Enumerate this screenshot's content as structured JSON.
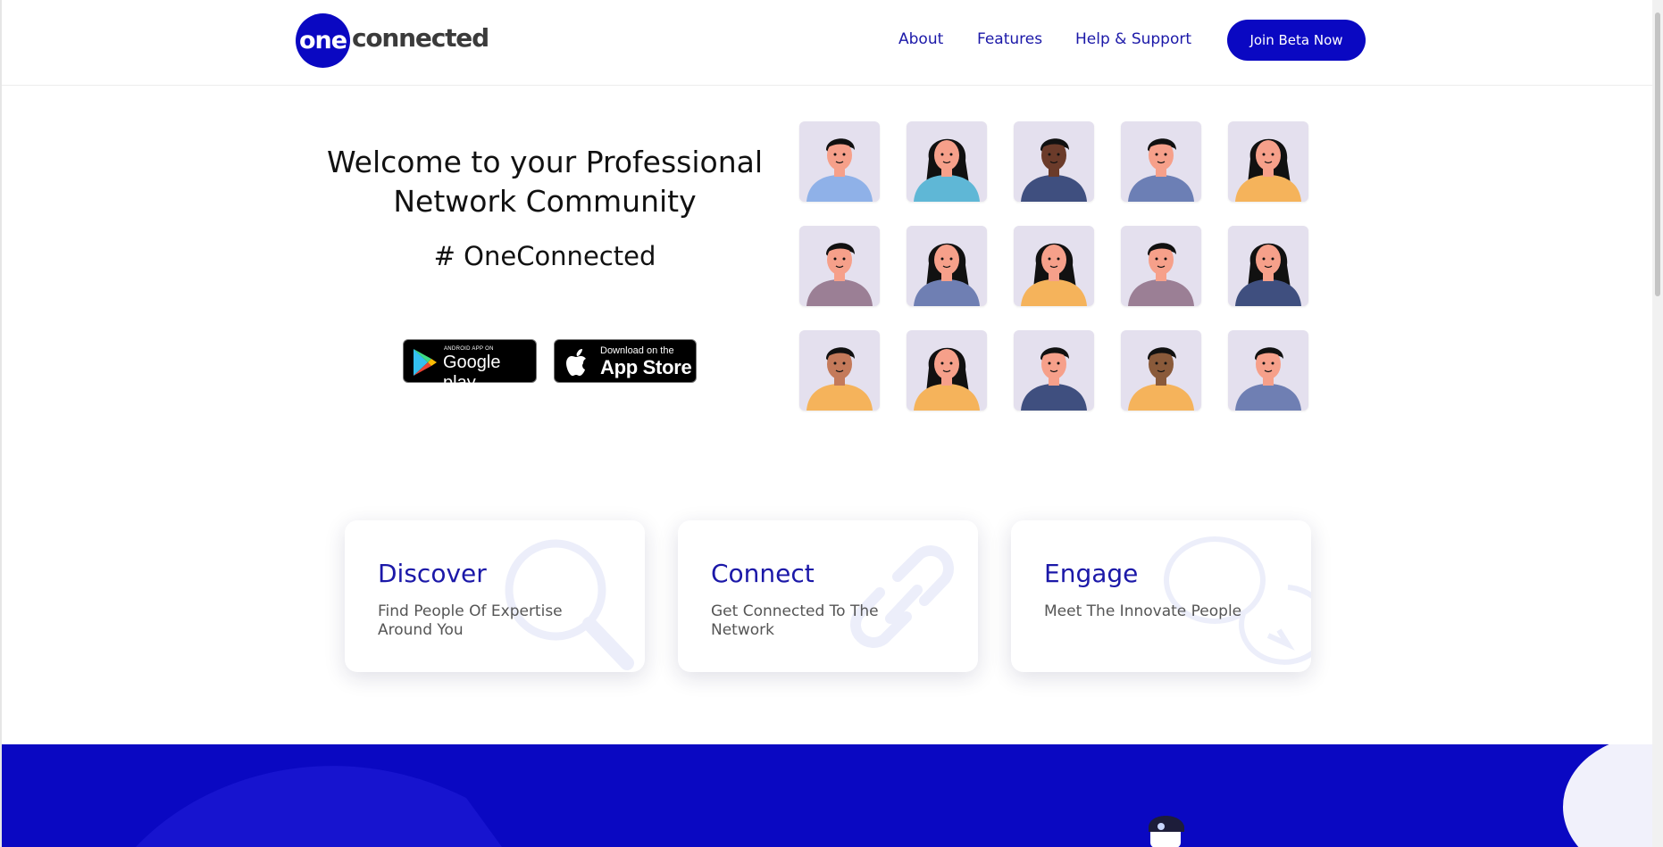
{
  "header": {
    "logo_mark": "one",
    "logo_text": "connected",
    "nav": [
      "About",
      "Features",
      "Help & Support"
    ],
    "cta": "Join Beta Now"
  },
  "hero": {
    "title": "Welcome to your Professional Network Community",
    "hashtag": "# OneConnected",
    "google_play": {
      "small": "ANDROID APP ON",
      "big": "Google play"
    },
    "app_store": {
      "small": "Download on the",
      "big": "App Store"
    }
  },
  "avatars": {
    "count": 15,
    "colors": {
      "tile": "#e4e0ee",
      "skin": "#f6a08a",
      "hair": "#111111"
    }
  },
  "features": [
    {
      "title": "Discover",
      "desc": "Find People Of Expertise Around You",
      "icon": "search-icon"
    },
    {
      "title": "Connect",
      "desc": "Get Connected To The Network",
      "icon": "link-icon"
    },
    {
      "title": "Engage",
      "desc": "Meet The Innovate People",
      "icon": "chat-bubbles-icon"
    }
  ],
  "colors": {
    "brand": "#0a08c2",
    "nav_text": "#1b18a8",
    "band": "#0a08c2"
  }
}
